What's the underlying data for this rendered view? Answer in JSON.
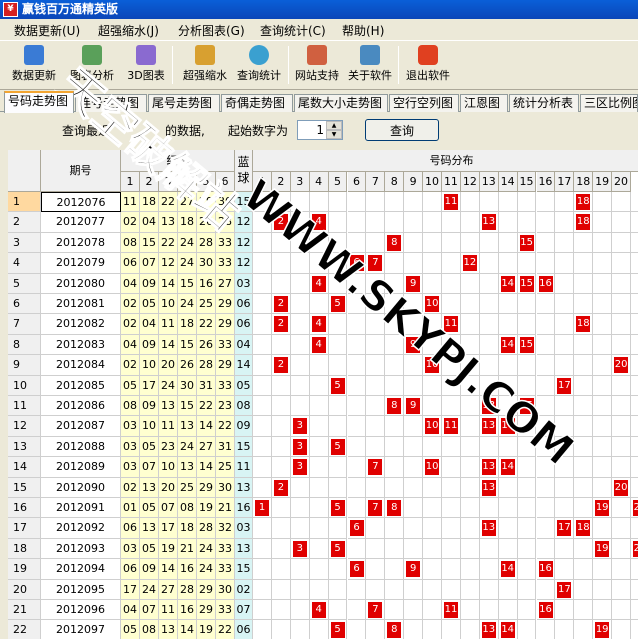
{
  "title": "赢钱百万通精英版",
  "menu": [
    "数据更新(U)",
    "超强缩水(J)",
    "分析图表(G)",
    "查询统计(C)",
    "帮助(H)"
  ],
  "toolbar": [
    "数据更新",
    "图表分析",
    "3D图表",
    "超强缩水",
    "查询统计",
    "网站支持",
    "关于软件",
    "退出软件"
  ],
  "tabs": [
    "号码走势图",
    "连号走势图",
    "尾号走势图",
    "奇偶走势图",
    "尾数大小走势图",
    "空行空列图",
    "江恩图",
    "统计分析表",
    "三区比例图"
  ],
  "query": {
    "prefix": "查询最近",
    "suffix": "的数据,",
    "start_label": "起始数字为",
    "start_value": "1",
    "button": "查询"
  },
  "grid": {
    "period_header": "期号",
    "red_header": "红球",
    "blue_header": "蓝球",
    "dist_header": "号码分布",
    "red_cols": [
      "1",
      "2",
      "3",
      "4",
      "5",
      "6"
    ],
    "dist_cols": [
      "1",
      "2",
      "3",
      "4",
      "5",
      "6",
      "7",
      "8",
      "9",
      "10",
      "11",
      "12",
      "13",
      "14",
      "15",
      "16",
      "17",
      "18",
      "19",
      "20"
    ],
    "rows": [
      {
        "n": "1",
        "p": "2012076",
        "r": [
          "11",
          "18",
          "22",
          "27",
          "29",
          "30"
        ],
        "b": "15"
      },
      {
        "n": "2",
        "p": "2012077",
        "r": [
          "02",
          "04",
          "13",
          "18",
          "26",
          "28"
        ],
        "b": "12"
      },
      {
        "n": "3",
        "p": "2012078",
        "r": [
          "08",
          "15",
          "22",
          "24",
          "28",
          "33"
        ],
        "b": "12"
      },
      {
        "n": "4",
        "p": "2012079",
        "r": [
          "06",
          "07",
          "12",
          "24",
          "30",
          "33"
        ],
        "b": "12"
      },
      {
        "n": "5",
        "p": "2012080",
        "r": [
          "04",
          "09",
          "14",
          "15",
          "16",
          "27"
        ],
        "b": "03"
      },
      {
        "n": "6",
        "p": "2012081",
        "r": [
          "02",
          "05",
          "10",
          "24",
          "25",
          "29"
        ],
        "b": "06"
      },
      {
        "n": "7",
        "p": "2012082",
        "r": [
          "02",
          "04",
          "11",
          "18",
          "22",
          "29"
        ],
        "b": "06"
      },
      {
        "n": "8",
        "p": "2012083",
        "r": [
          "04",
          "09",
          "14",
          "15",
          "26",
          "33"
        ],
        "b": "04"
      },
      {
        "n": "9",
        "p": "2012084",
        "r": [
          "02",
          "10",
          "20",
          "26",
          "28",
          "29"
        ],
        "b": "14"
      },
      {
        "n": "10",
        "p": "2012085",
        "r": [
          "05",
          "17",
          "24",
          "30",
          "31",
          "33"
        ],
        "b": "05"
      },
      {
        "n": "11",
        "p": "2012086",
        "r": [
          "08",
          "09",
          "13",
          "15",
          "22",
          "23"
        ],
        "b": "08"
      },
      {
        "n": "12",
        "p": "2012087",
        "r": [
          "03",
          "10",
          "11",
          "13",
          "14",
          "22"
        ],
        "b": "09"
      },
      {
        "n": "13",
        "p": "2012088",
        "r": [
          "03",
          "05",
          "23",
          "24",
          "27",
          "31"
        ],
        "b": "15"
      },
      {
        "n": "14",
        "p": "2012089",
        "r": [
          "03",
          "07",
          "10",
          "13",
          "14",
          "25"
        ],
        "b": "11"
      },
      {
        "n": "15",
        "p": "2012090",
        "r": [
          "02",
          "13",
          "20",
          "25",
          "29",
          "30"
        ],
        "b": "13"
      },
      {
        "n": "16",
        "p": "2012091",
        "r": [
          "01",
          "05",
          "07",
          "08",
          "19",
          "21"
        ],
        "b": "16"
      },
      {
        "n": "17",
        "p": "2012092",
        "r": [
          "06",
          "13",
          "17",
          "18",
          "28",
          "32"
        ],
        "b": "03"
      },
      {
        "n": "18",
        "p": "2012093",
        "r": [
          "03",
          "05",
          "19",
          "21",
          "24",
          "33"
        ],
        "b": "13"
      },
      {
        "n": "19",
        "p": "2012094",
        "r": [
          "06",
          "09",
          "14",
          "16",
          "24",
          "33"
        ],
        "b": "15"
      },
      {
        "n": "20",
        "p": "2012095",
        "r": [
          "17",
          "24",
          "27",
          "28",
          "29",
          "30"
        ],
        "b": "02"
      },
      {
        "n": "21",
        "p": "2012096",
        "r": [
          "04",
          "07",
          "11",
          "16",
          "29",
          "33"
        ],
        "b": "07"
      },
      {
        "n": "22",
        "p": "2012097",
        "r": [
          "05",
          "08",
          "13",
          "14",
          "19",
          "22"
        ],
        "b": "06"
      }
    ]
  },
  "watermark": {
    "cn": "天空破解站",
    "url": "WWW.SKYPJ.COM"
  },
  "colors": {
    "hit": "#e00000",
    "titlebar": "#0b50c8"
  }
}
